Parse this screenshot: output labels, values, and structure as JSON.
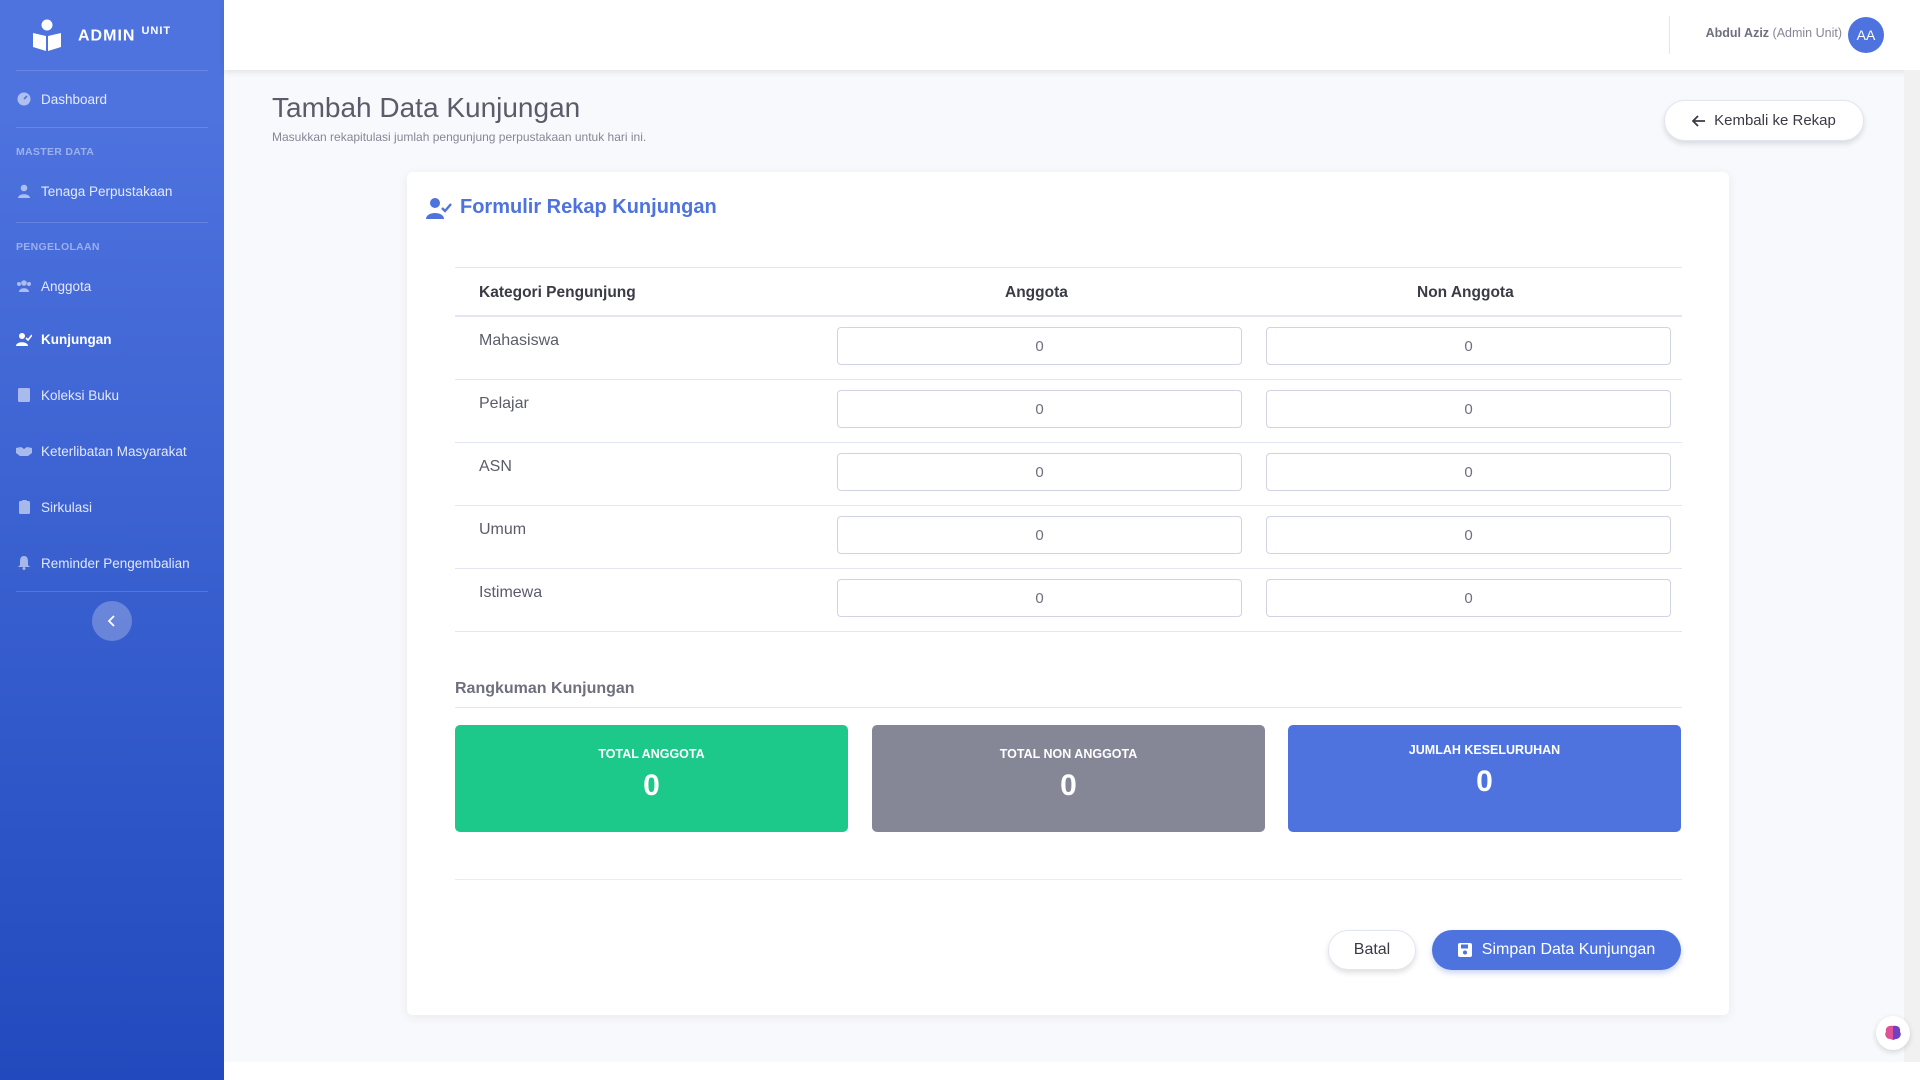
{
  "brand": {
    "name": "ADMIN",
    "suffix": "UNIT"
  },
  "sidebar": {
    "items": [
      {
        "label": "Dashboard",
        "icon": "gauge-icon"
      },
      {
        "heading": "MASTER DATA"
      },
      {
        "label": "Tenaga Perpustakaan",
        "icon": "user-icon"
      },
      {
        "heading": "PENGELOLAAN"
      },
      {
        "label": "Anggota",
        "icon": "users-icon"
      },
      {
        "label": "Kunjungan",
        "icon": "user-check-icon",
        "active": true
      },
      {
        "label": "Koleksi Buku",
        "icon": "book-icon"
      },
      {
        "label": "Keterlibatan Masyarakat",
        "icon": "handshake-icon"
      },
      {
        "label": "Sirkulasi",
        "icon": "clipboard-icon"
      },
      {
        "label": "Reminder Pengembalian",
        "icon": "bell-icon"
      }
    ],
    "toggle_icon": "chevron-left-icon"
  },
  "topbar": {
    "user_name": "Abdul Aziz",
    "user_role": "(Admin Unit)",
    "avatar_initials": "AA"
  },
  "page": {
    "title": "Tambah Data Kunjungan",
    "subtitle": "Masukkan rekapitulasi jumlah pengunjung perpustakaan untuk hari ini.",
    "back_label": "Kembali ke Rekap"
  },
  "form": {
    "title": "Formulir Rekap Kunjungan",
    "headers": {
      "category": "Kategori Pengunjung",
      "member": "Anggota",
      "non_member": "Non Anggota"
    },
    "rows": [
      {
        "label": "Mahasiswa",
        "member": "0",
        "non_member": "0"
      },
      {
        "label": "Pelajar",
        "member": "0",
        "non_member": "0"
      },
      {
        "label": "ASN",
        "member": "0",
        "non_member": "0"
      },
      {
        "label": "Umum",
        "member": "0",
        "non_member": "0"
      },
      {
        "label": "Istimewa",
        "member": "0",
        "non_member": "0"
      }
    ]
  },
  "summary": {
    "title": "Rangkuman Kunjungan",
    "total_member_label": "TOTAL ANGGOTA",
    "total_member_value": "0",
    "total_non_member_label": "TOTAL NON ANGGOTA",
    "total_non_member_value": "0",
    "grand_total_label": "JUMLAH KESELURUHAN",
    "grand_total_value": "0"
  },
  "actions": {
    "cancel": "Batal",
    "save": "Simpan Data Kunjungan"
  },
  "colors": {
    "primary": "#4e73df",
    "success": "#1cc88a",
    "secondary": "#858796"
  }
}
